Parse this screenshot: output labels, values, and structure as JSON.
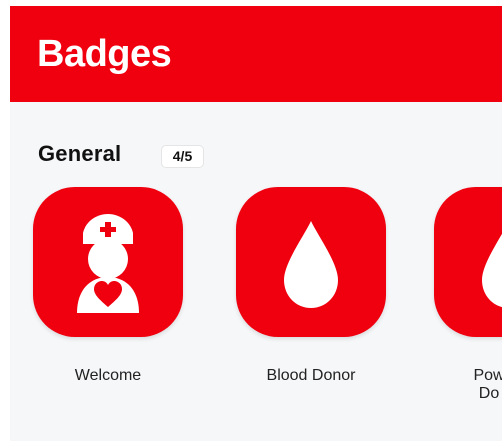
{
  "header": {
    "title": "Badges",
    "background_color": "#f0000f"
  },
  "section": {
    "title": "General",
    "count": "4/5"
  },
  "badges": [
    {
      "label": "Welcome",
      "icon": "nurse-heart-icon"
    },
    {
      "label": "Blood Donor",
      "icon": "blood-drop-icon"
    },
    {
      "label": "Pow\nDo",
      "icon": "blood-drop-icon"
    }
  ],
  "colors": {
    "accent": "#f0000f",
    "background": "#f6f7f9",
    "text": "#111111"
  }
}
